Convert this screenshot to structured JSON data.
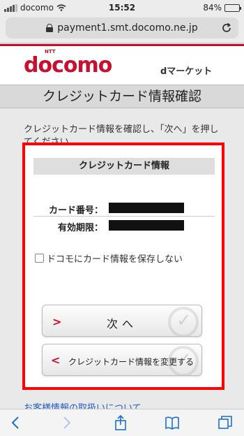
{
  "status": {
    "carrier": "docomo",
    "time": "15:52",
    "battery": "84%"
  },
  "browser": {
    "url": "payment1.smt.docomo.ne.jp"
  },
  "header": {
    "logo_ntt": "NTT",
    "logo": "docomo",
    "service": "dマーケット"
  },
  "page": {
    "title": "クレジットカード情報確認",
    "instruction": "クレジットカード情報を確認し、「次へ」を押してください。"
  },
  "card": {
    "heading": "クレジットカード情報",
    "rows": [
      {
        "label": "カード番号："
      },
      {
        "label": "有効期限："
      }
    ],
    "save_option": "ドコモにカード情報を保存しない"
  },
  "buttons": {
    "next": "次へ",
    "change": "クレジットカード情報を変更する"
  },
  "footer_link": "お客様情報の取扱いについて",
  "colors": {
    "brand": "#c8102e",
    "highlight": "#ff0000"
  }
}
